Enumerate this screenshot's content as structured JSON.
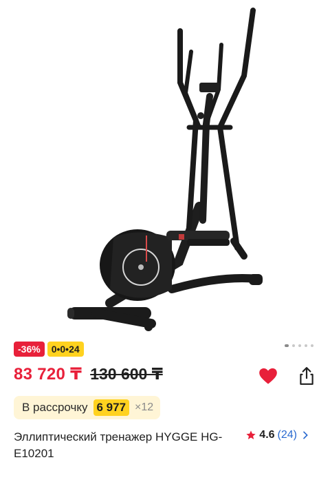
{
  "gallery": {
    "image_name": "elliptical-trainer-photo",
    "dots": [
      true,
      false,
      false,
      false,
      false
    ]
  },
  "badges": {
    "discount": "-36%",
    "installment": "0•0•24"
  },
  "price": {
    "current": "83 720 ₸",
    "old": "130 600 ₸"
  },
  "actions": {
    "favorite_icon": "heart-icon",
    "share_icon": "share-icon",
    "favorite_color": "#e8203a"
  },
  "installment": {
    "label": "В рассрочку",
    "amount": "6 977",
    "multiplier": "×12"
  },
  "product": {
    "title": "Эллиптический тренажер HYGGE HG-E10201",
    "rating_value": "4.6",
    "rating_count": "(24)"
  },
  "colors": {
    "accent_red": "#e8203a",
    "accent_yellow": "#ffd21f",
    "link_blue": "#2a6ad0"
  }
}
